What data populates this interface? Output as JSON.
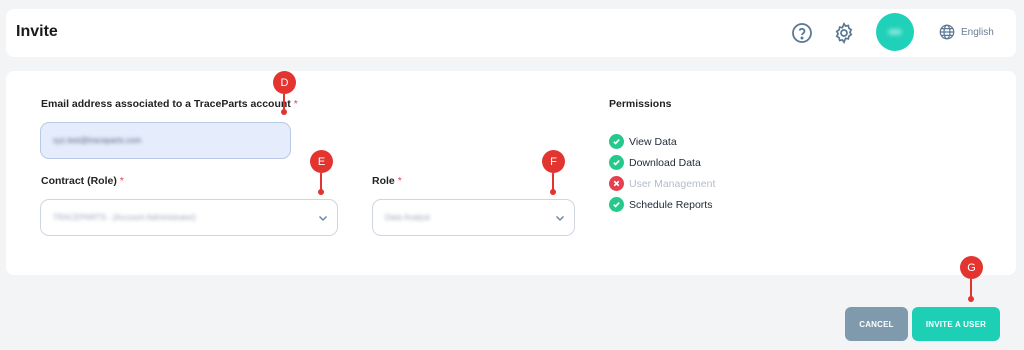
{
  "header": {
    "title": "Invite",
    "language": "English"
  },
  "form": {
    "email": {
      "label": "Email address associated to a TraceParts account",
      "required_mark": "*",
      "value": "xyz.test@traceparts.com"
    },
    "contract": {
      "label": "Contract (Role)",
      "required_mark": "*",
      "value": "TRACEPARTS - [Account Administrator]"
    },
    "role": {
      "label": "Role",
      "required_mark": "*",
      "value": "Data Analyst"
    }
  },
  "permissions": {
    "title": "Permissions",
    "items": [
      {
        "label": "View Data",
        "enabled": true
      },
      {
        "label": "Download Data",
        "enabled": true
      },
      {
        "label": "User Management",
        "enabled": false
      },
      {
        "label": "Schedule Reports",
        "enabled": true
      }
    ]
  },
  "actions": {
    "cancel": "CANCEL",
    "invite": "INVITE A USER"
  },
  "markers": [
    "D",
    "E",
    "F",
    "G"
  ],
  "colors": {
    "accent": "#1dcfb5",
    "cancel": "#7f99ad",
    "marker": "#e3342f",
    "check": "#26c98c",
    "cross": "#e64050"
  },
  "icons": [
    "help-icon",
    "settings-icon",
    "globe-icon",
    "chevron-down-icon",
    "check-icon",
    "close-icon"
  ]
}
